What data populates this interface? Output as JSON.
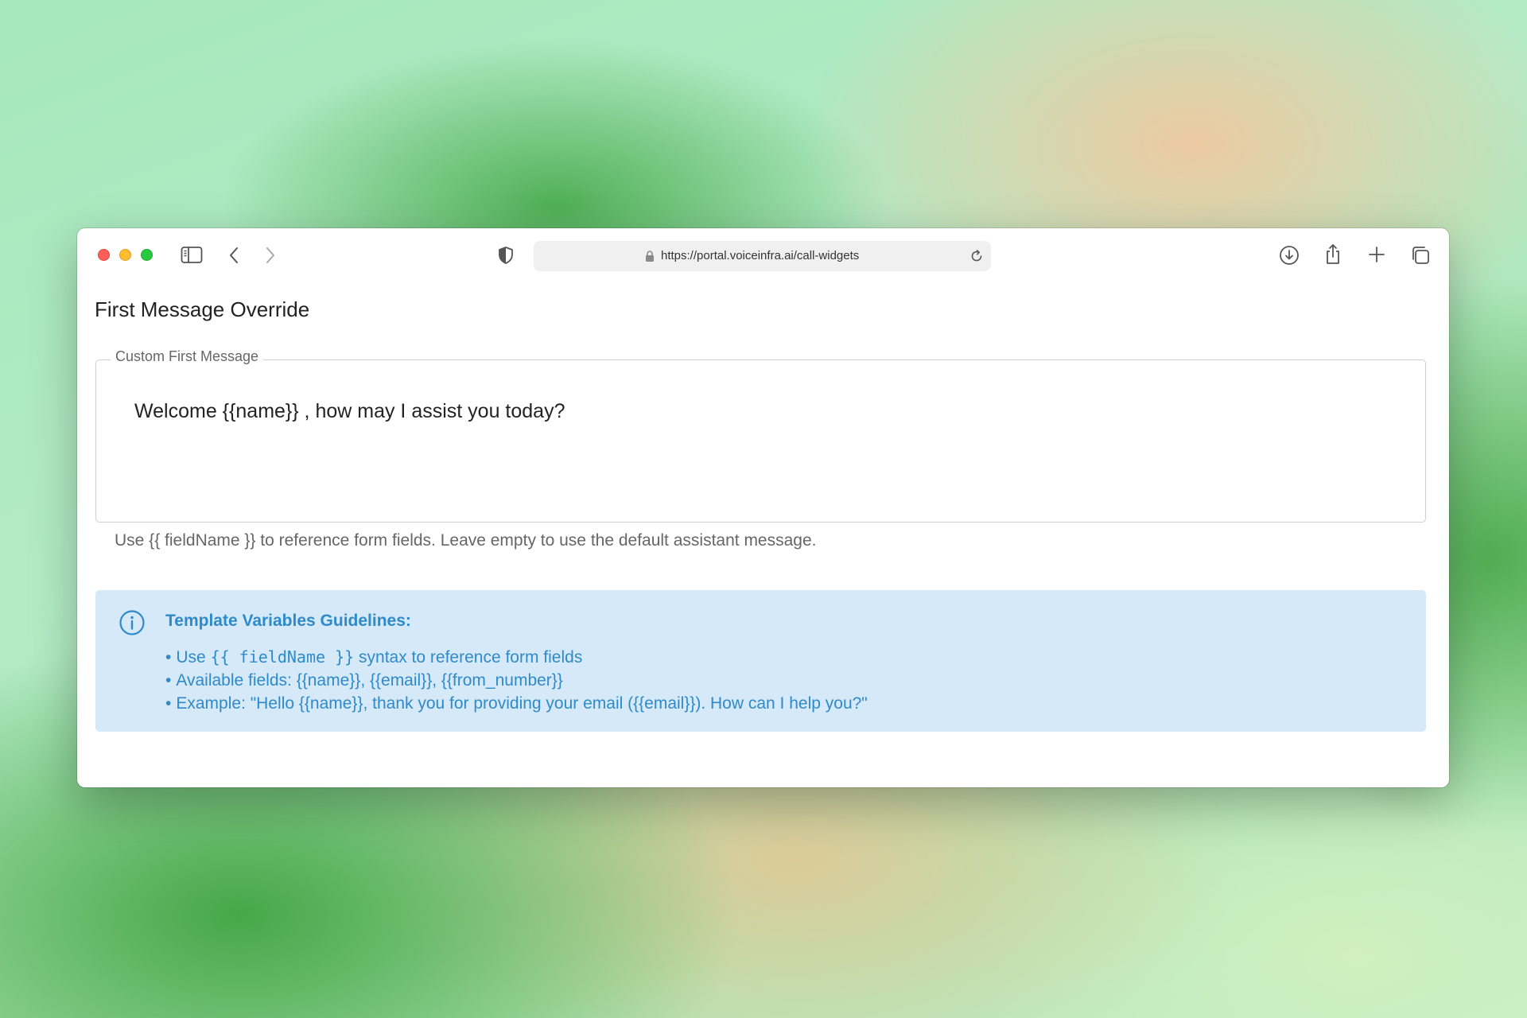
{
  "browser": {
    "url": "https://portal.voiceinfra.ai/call-widgets",
    "icons": [
      "sidebar-icon",
      "back-icon",
      "forward-icon",
      "shield-icon",
      "lock-icon",
      "reload-icon",
      "download-icon",
      "share-icon",
      "new-tab-icon",
      "tabs-icon"
    ]
  },
  "page": {
    "title": "First Message Override",
    "field_label": "Custom First Message",
    "field_value": "Welcome {{name}} , how may I assist you today?",
    "helper_text": "Use {{ fieldName }} to reference form fields. Leave empty to use the default assistant message."
  },
  "guidelines": {
    "title": "Template Variables Guidelines:",
    "bullet": "•",
    "item1_prefix": "Use",
    "item1_code": "{{ fieldName }}",
    "item1_suffix": "syntax to reference form fields",
    "item2": "Available fields: {{name}}, {{email}}, {{from_number}}",
    "item3": "Example: \"Hello {{name}}, thank you for providing your email ({{email}}). How can I help you?\""
  },
  "colors": {
    "info_background": "#d6e9f8",
    "info_text": "#2f8ac9",
    "traffic_red": "#ff5f57",
    "traffic_yellow": "#febc2e",
    "traffic_green": "#28c840"
  }
}
